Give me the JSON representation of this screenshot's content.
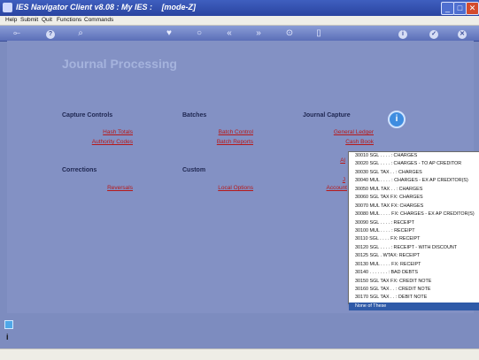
{
  "window": {
    "title": "IES Navigator Client v8.08 : My IES :",
    "mode": "[mode-Z]"
  },
  "menu": [
    "Help",
    "Submit",
    "Quit",
    "Functions",
    "Commands"
  ],
  "toolbar": {
    "key_icon": "⟜",
    "help": "?",
    "search": "⌕",
    "heart": "♥",
    "back2": "«",
    "fwd2": "»",
    "record": "⊙",
    "info": "i",
    "ok": "✓",
    "cancel": "✕"
  },
  "page": {
    "title": "Journal Processing"
  },
  "sections": {
    "capture": {
      "label": "Capture Controls",
      "links": [
        "Hash Totals",
        "Authority Codes"
      ]
    },
    "batches": {
      "label": "Batches",
      "links": [
        "Batch Control",
        "Batch Reports"
      ]
    },
    "journal": {
      "label": "Journal Capture",
      "links": [
        "General Ledger",
        "Cash Book",
        "Al",
        "J",
        "Account"
      ]
    },
    "corrections": {
      "label": "Corrections",
      "links": [
        "Reversals"
      ]
    },
    "custom": {
      "label": "Custom",
      "links": [
        "Local Options"
      ]
    }
  },
  "dropdown": {
    "items": [
      "30010 SGL . . . . : CHARGES",
      "30020 SGL . . . . : CHARGES - TO AP CREDITOR",
      "30030 SGL TAX . . : CHARGES",
      "30040 MUL . . . . : CHARGES - EX AP CREDITOR(S)",
      "30050 MUL TAX . . : CHARGES",
      "30060 SGL TAX FX: CHARGES",
      "30070 MUL TAX FX: CHARGES",
      "30080 MUL . . . . FX: CHARGES - EX AP CREDITOR(S)",
      "30090 SGL . . . . : RECEIPT",
      "30100 MUL . . . . : RECEIPT",
      "30110 SGL . . . . FX: RECEIPT",
      "30120 SGL . . . . : RECEIPT - WITH DISCOUNT",
      "30125 SGL . WTAX: RECEIPT",
      "30130 MUL . . . . FX: RECEIPT",
      "30140 . . . . . . . : BAD DEBTS",
      "30150 SGL TAX FX: CREDIT NOTE",
      "30160 SGL TAX . . : CREDIT NOTE",
      "30170 SGL TAX . . : DEBIT NOTE",
      "None of These"
    ],
    "selected_index": 18
  },
  "side": {
    "info_glyph": "i"
  },
  "colors": {
    "link": "#b81818",
    "background": "#8391c4",
    "selected": "#2f5aa8"
  }
}
